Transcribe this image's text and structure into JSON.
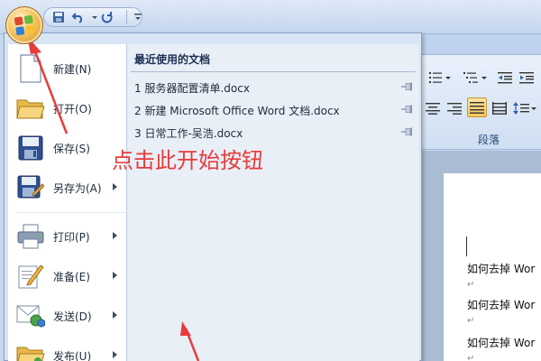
{
  "menu": {
    "items": [
      {
        "label": "新建(N)",
        "icon": "new-document-icon",
        "has_submenu": false
      },
      {
        "label": "打开(O)",
        "icon": "open-folder-icon",
        "has_submenu": false
      },
      {
        "label": "保存(S)",
        "icon": "save-disk-icon",
        "has_submenu": false
      },
      {
        "label": "另存为(A)",
        "icon": "save-as-icon",
        "has_submenu": true
      },
      {
        "label": "打印(P)",
        "icon": "printer-icon",
        "has_submenu": true
      },
      {
        "label": "准备(E)",
        "icon": "prepare-pencil-icon",
        "has_submenu": true
      },
      {
        "label": "发送(D)",
        "icon": "send-mail-icon",
        "has_submenu": true
      },
      {
        "label": "发布(U)",
        "icon": "publish-folder-icon",
        "has_submenu": true
      }
    ],
    "recent": {
      "title": "最近使用的文档",
      "items": [
        {
          "label": "1 服务器配置清单.docx"
        },
        {
          "label": "2 新建 Microsoft Office Word 文档.docx"
        },
        {
          "label": "3 日常工作-吴浩.docx"
        }
      ]
    }
  },
  "ribbon": {
    "group_label": "段落"
  },
  "document": {
    "lines": [
      "如何去掉 Wor",
      "如何去掉 Wor",
      "如何去掉 Wor"
    ],
    "paragraph_mark": "↵"
  },
  "annotation": {
    "text": "点击此开始按钮",
    "color": "#e83b3b"
  },
  "colors": {
    "menu_bg": "#d8e5f5",
    "ribbon_active": "#f7c75a",
    "annotation_red": "#e83b3b"
  }
}
